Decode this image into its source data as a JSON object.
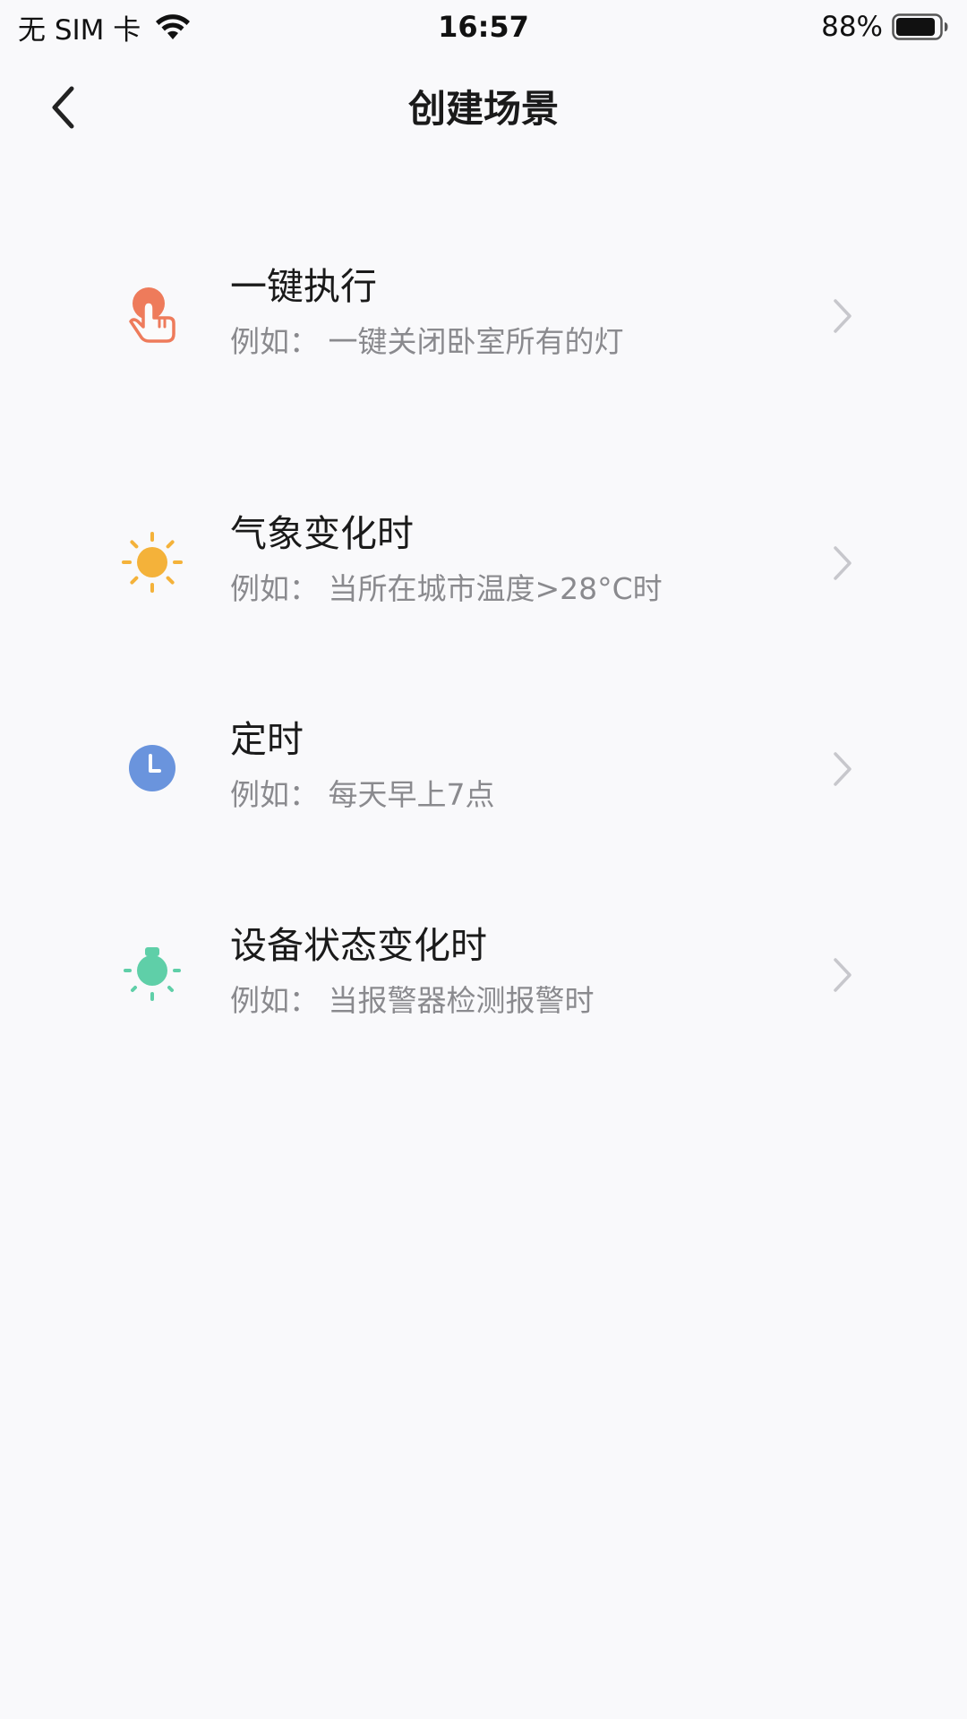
{
  "status_bar": {
    "carrier": "无 SIM 卡",
    "time": "16:57",
    "battery": "88%"
  },
  "nav": {
    "title": "创建场景",
    "back_icon": "chevron-left-icon"
  },
  "items": [
    {
      "title": "一键执行",
      "desc": "例如： 一键关闭卧室所有的灯",
      "icon": "tap-hand-icon",
      "color": "#EE7B5B"
    },
    {
      "title": "气象变化时",
      "desc": "例如： 当所在城市温度>28°C时",
      "icon": "sun-icon",
      "color": "#F4B23A"
    },
    {
      "title": "定时",
      "desc": "例如： 每天早上7点",
      "icon": "clock-icon",
      "color": "#6A94DD"
    },
    {
      "title": "设备状态变化时",
      "desc": "例如： 当报警器检测报警时",
      "icon": "bulb-icon",
      "color": "#5FCFA8"
    }
  ]
}
